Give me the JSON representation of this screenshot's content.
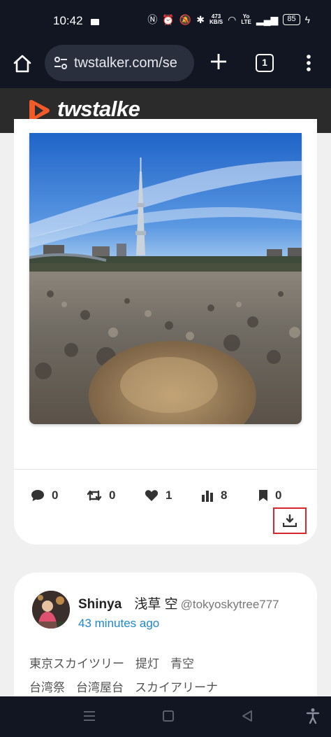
{
  "status_bar": {
    "time": "10:42",
    "network_speed_value": "473",
    "network_speed_unit": "KB/S",
    "volte_top": "Yo",
    "volte_bottom": "LTE",
    "battery": "85"
  },
  "browser": {
    "url": "twstalker.com/se",
    "tab_count": "1"
  },
  "site": {
    "logo_text": "twstalke",
    "brand_color": "#f15a29"
  },
  "post1": {
    "stats": {
      "replies": "0",
      "retweets": "0",
      "likes": "1",
      "views": "8",
      "bookmarks": "0"
    }
  },
  "post2": {
    "author_name": "Shinya",
    "author_name_jp": "浅草 空",
    "author_handle": "@tokyoskytree777",
    "time": "43 minutes ago",
    "tags_line1": [
      "東京スカイツリー",
      "提灯",
      "青空"
    ],
    "tags_line2": [
      "台湾祭",
      "台湾屋台",
      "スカイアリーナ"
    ]
  },
  "icons": {
    "home": "home-icon",
    "tune": "site-settings-icon",
    "plus": "new-tab-icon",
    "menu": "more-vert-icon",
    "reply": "comment-icon",
    "retweet": "retweet-icon",
    "like": "heart-icon",
    "views": "bar-chart-icon",
    "bookmark": "bookmark-icon",
    "download": "download-icon"
  },
  "colors": {
    "link": "#1e88c9",
    "highlight_box": "#d9262c",
    "chrome_dark": "#121623"
  }
}
